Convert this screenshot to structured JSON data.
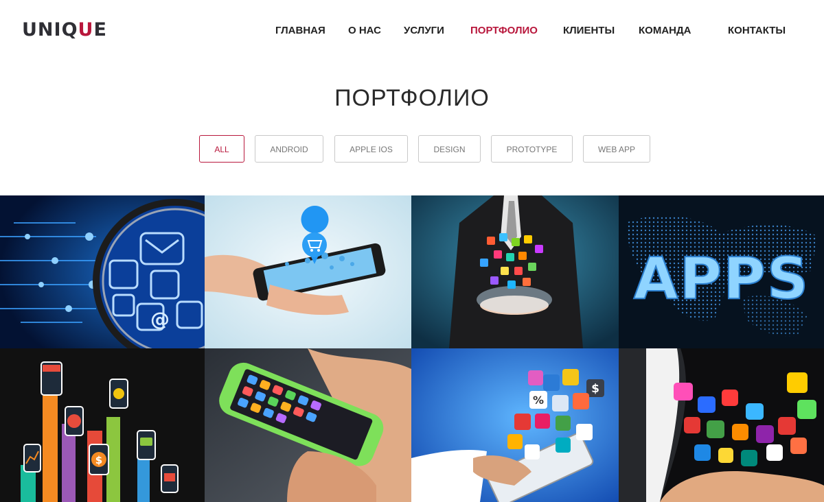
{
  "logo": {
    "text_main": "UNIQ",
    "text_accent": "U",
    "text_end": "E"
  },
  "nav": {
    "items": [
      "ГЛАВНАЯ",
      "О НАС",
      "УСЛУГИ",
      "ПОРТФОЛИО",
      "КЛИЕНТЫ",
      "КОМАНДА",
      "КОНТАКТЫ"
    ],
    "active": "ПОРТФОЛИО"
  },
  "portfolio": {
    "title": "ПОРТФОЛИО",
    "filters": [
      "ALL",
      "ANDROID",
      "APPLE IOS",
      "DESIGN",
      "PROTOTYPE",
      "WEB APP"
    ],
    "active_filter": "ALL"
  },
  "tiles": {
    "apps_text": "APPS",
    "dollar": "$",
    "percent": "%"
  },
  "colors": {
    "accent": "#b8173c",
    "text_dark": "#2f2f35"
  }
}
